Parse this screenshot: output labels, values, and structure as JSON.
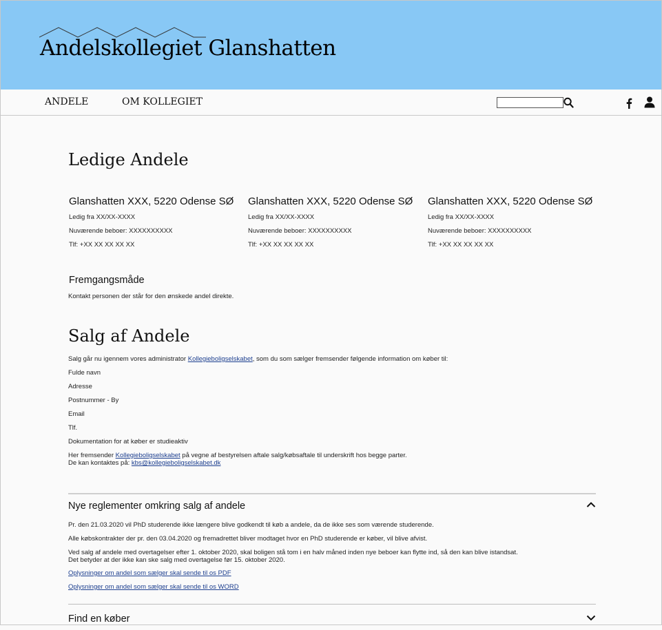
{
  "header": {
    "site_title": "Andelskollegiet Glanshatten",
    "logo_icon": "mountains-icon",
    "background": "#88c8f5"
  },
  "nav": {
    "items": [
      {
        "label": "ANDELE"
      },
      {
        "label": "OM KOLLEGIET"
      }
    ],
    "search_placeholder": "",
    "search_icon": "search-icon",
    "facebook_icon": "facebook-icon",
    "user_icon": "user-icon"
  },
  "vacancies": {
    "heading": "Ledige Andele",
    "cards": [
      {
        "title": "Glanshatten XXX, 5220 Odense SØ",
        "available": "Ledig fra XX/XX-XXXX",
        "resident": "Nuværende beboer: XXXXXXXXXX",
        "phone": "Tlf: +XX XX XX XX XX"
      },
      {
        "title": "Glanshatten XXX, 5220 Odense SØ",
        "available": "Ledig fra XX/XX-XXXX",
        "resident": "Nuværende beboer: XXXXXXXXXX",
        "phone": "Tlf: +XX XX XX XX XX"
      },
      {
        "title": "Glanshatten XXX, 5220 Odense SØ",
        "available": "Ledig fra XX/XX-XXXX",
        "resident": "Nuværende beboer: XXXXXXXXXX",
        "phone": "Tlf: +XX XX XX XX XX"
      }
    ],
    "procedure_heading": "Fremgangsmåde",
    "procedure_text": "Kontakt personen der står for den ønskede andel direkte."
  },
  "sales": {
    "heading": "Salg af Andele",
    "intro_before": "Salg går nu igennem vores administrator ",
    "intro_link": "Kollegieboligselskabet",
    "intro_after": ", som du som sælger fremsender følgende information om køber til:",
    "fields": [
      "Fulde navn",
      "Adresse",
      "Postnummer - By",
      "Email",
      "Tlf.",
      "Dokumentation for at køber er studieaktiv"
    ],
    "send_before": "Her fremsender ",
    "send_link": "Kollegieboligselskabet",
    "send_after": " på vegne af bestyrelsen aftale salg/købsaftale til underskrift hos begge parter.",
    "contact_before": "De kan kontaktes på: ",
    "contact_link": "kbs@kollegieboligselskabet.dk"
  },
  "accordion": [
    {
      "title": "Nye reglementer omkring salg af andele",
      "expanded": true,
      "lines": [
        "Pr. den 21.03.2020 vil PhD studerende ikke længere blive godkendt til køb a andele, da de ikke ses som værende studerende.",
        "Alle købskontrakter der pr. den 03.04.2020 og fremadrettet bliver modtaget hvor en PhD studerende er køber, vil blive afvist.",
        "Ved salg af andele med overtagelser efter 1. oktober 2020, skal boligen stå tom i en halv måned inden nye beboer kan flytte ind, så den kan blive istandsat.",
        "Det betyder at der ikke kan ske salg med overtagelse før 15. oktober 2020."
      ],
      "links": [
        "Oplysninger om andel som sælger skal sende til os PDF",
        "Oplysninger om andel som sælger skal sende til os WORD"
      ]
    },
    {
      "title": "Find en køber",
      "expanded": false
    }
  ]
}
